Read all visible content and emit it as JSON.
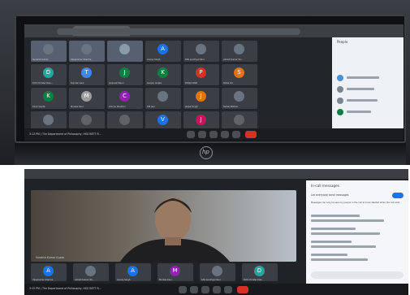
{
  "photo_top": {
    "people_panel": {
      "title": "People"
    },
    "participants": [
      "Suraksh Kumar",
      "Vijaykumar Sharma",
      "",
      "Anoop Singh",
      "KSS sandhya Devi",
      "Ashish Kumar Sh...",
      "DVS Christa Chau...",
      "Tejinder kaur",
      "Jaspreet Mann",
      "Gunjan Gupta",
      "POOJA RANI",
      "Shiba Ori",
      "Kiran Gupta",
      "Monika Kaur",
      "Chinnu Pandhiri",
      "DM Jain",
      "Jaspal Singh",
      "Suhail Malhan",
      "",
      "",
      "",
      "Deepak Batra",
      "Jaspreet Kaur",
      "Vidhya Deol"
    ],
    "avatar_letters": [
      "",
      "",
      "",
      "A",
      "",
      "",
      "D",
      "T",
      "J",
      "K",
      "P",
      "S",
      "K",
      "M",
      "C",
      "",
      "J",
      "",
      "",
      "",
      "",
      "V",
      "J",
      ""
    ],
    "avatar_colors": [
      "#6a7380",
      "#6a7380",
      "#8a9aa8",
      "#1a73e8",
      "#6a7380",
      "#6a7380",
      "#26a69a",
      "#4285f4",
      "#0b8043",
      "#0b8043",
      "#d93025",
      "#e8710a",
      "#0b8043",
      "#9e9e9e",
      "#8e24aa",
      "#6a7380",
      "#e37400",
      "#6a7380",
      "#6a7380",
      "#5f6368",
      "#5f6368",
      "#1a73e8",
      "#c2185b",
      "#5f6368"
    ],
    "meeting_label": "3:13 PM | The Department of Philosophy, HSG BETT R...",
    "brand": "hp"
  },
  "photo_bottom": {
    "panel": {
      "title": "In-call messages",
      "toggle_label": "Let everyone send messages",
      "note": "Messages can only be seen by people in the call and are deleted when the call ends"
    },
    "speaker_label": "Suraksh Kumar Gupta",
    "strip": [
      "Vijaykumar Sharma",
      "Ashish Kumar Sh...",
      "Anoop Singh",
      "Monika Kaur",
      "KSS sandhya Devi",
      "DVS Christa Chau"
    ],
    "strip_letters": [
      "A",
      "",
      "A",
      "M",
      "",
      "D"
    ],
    "meeting_label": "3:15 PM | The Department of Philosophy, HSG BETT R..."
  }
}
